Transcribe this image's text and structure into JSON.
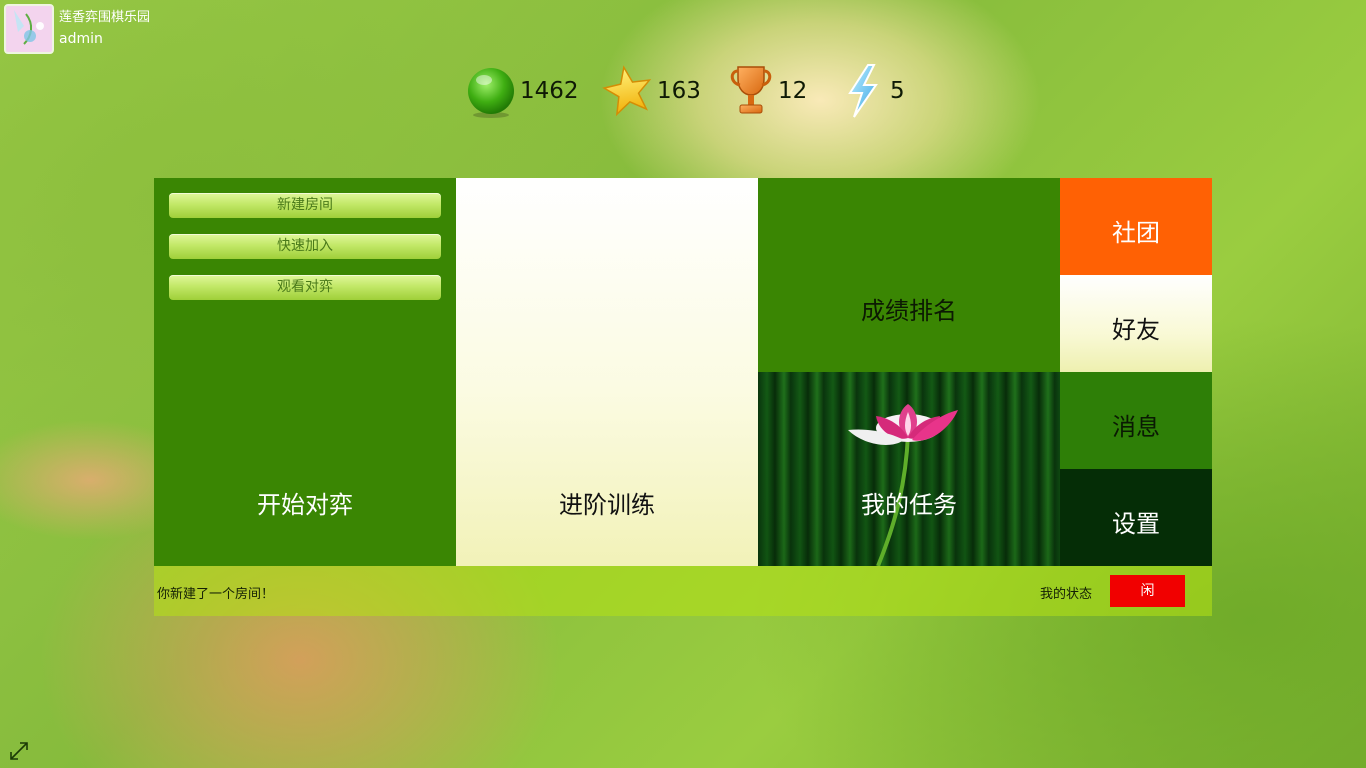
{
  "app": {
    "title": "莲香弈围棋乐园",
    "user": "admin"
  },
  "stats": [
    {
      "icon": "green-ball-icon",
      "value": "1462"
    },
    {
      "icon": "star-icon",
      "value": "163"
    },
    {
      "icon": "trophy-icon",
      "value": "12"
    },
    {
      "icon": "lightning-icon",
      "value": "5"
    }
  ],
  "tiles": {
    "start": {
      "label": "开始对弈",
      "buttons": [
        "新建房间",
        "快速加入",
        "观看对弈"
      ]
    },
    "train": {
      "label": "进阶训练"
    },
    "rank": {
      "label": "成绩排名"
    },
    "task": {
      "label": "我的任务"
    },
    "club": {
      "label": "社团"
    },
    "friend": {
      "label": "好友"
    },
    "message": {
      "label": "消息"
    },
    "settings": {
      "label": "设置"
    }
  },
  "status": {
    "message": "你新建了一个房间！",
    "label": "我的状态",
    "value": "闲"
  },
  "colors": {
    "accent_green": "#3a8603",
    "club_orange": "#ff6104",
    "status_red": "#f10000",
    "settings_dark": "#052d06"
  }
}
